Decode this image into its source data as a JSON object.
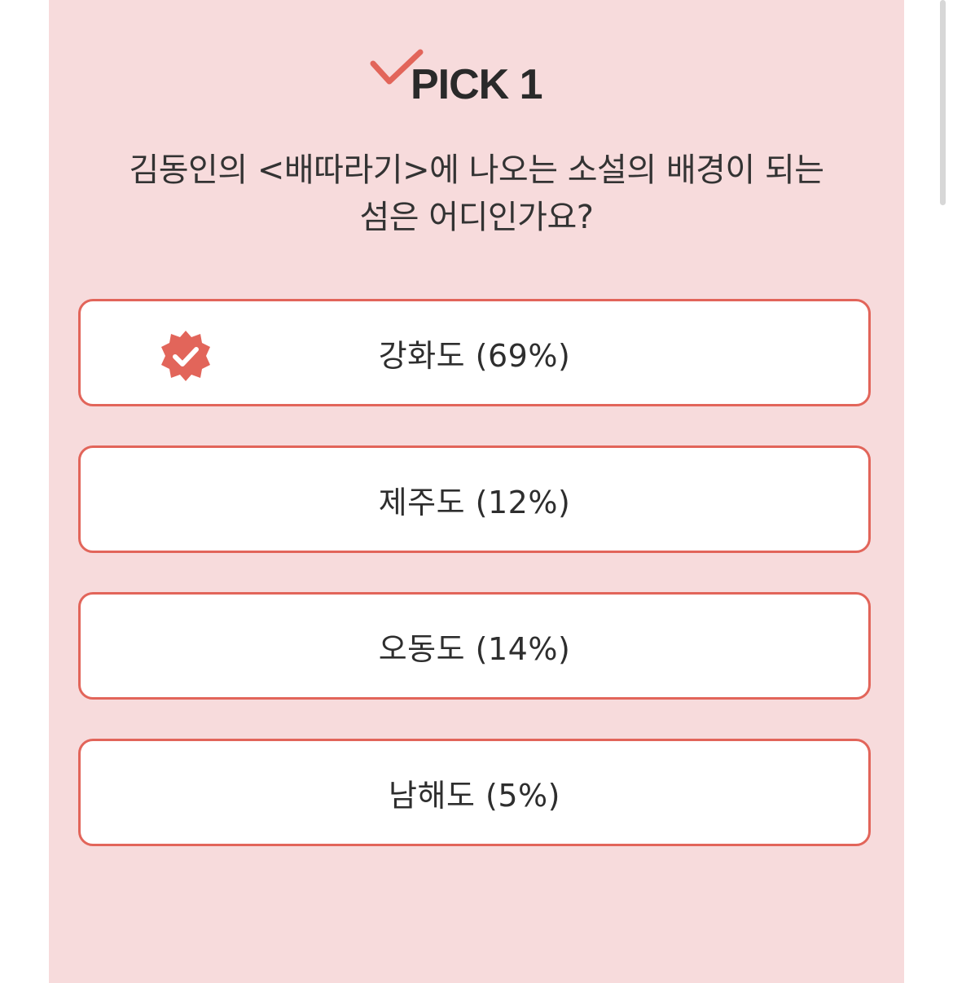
{
  "header": {
    "title": "PICK 1",
    "check_icon": "checkmark-icon"
  },
  "question": {
    "line1": "김동인의 <배따라기>에 나오는 소설의 배경이 되는",
    "line2": "섬은 어디인가요?"
  },
  "options": [
    {
      "label": "강화도 (69%)",
      "selected": true,
      "badge_icon": "verified-badge-icon"
    },
    {
      "label": "제주도 (12%)",
      "selected": false
    },
    {
      "label": "오동도 (14%)",
      "selected": false
    },
    {
      "label": "남해도 (5%)",
      "selected": false
    }
  ],
  "colors": {
    "card_background": "#f7dbdc",
    "accent": "#e2655a",
    "text": "#2e2e2e"
  }
}
